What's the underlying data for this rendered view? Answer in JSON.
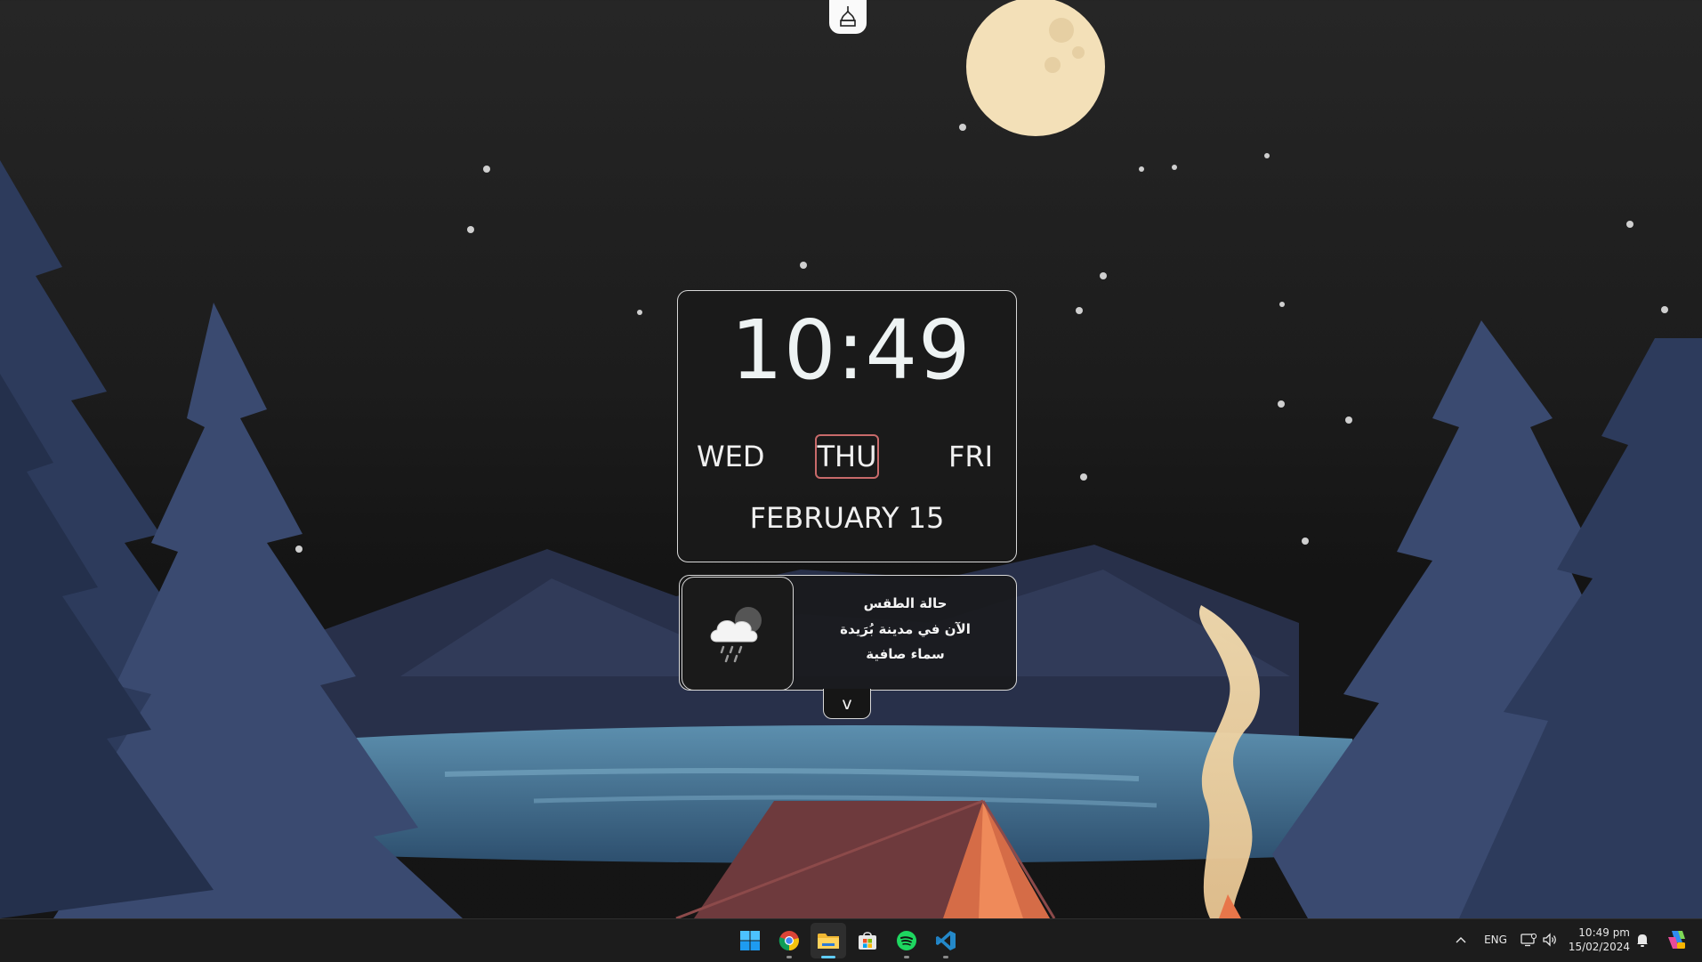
{
  "colors": {
    "accent_day_border": "#c86a6a",
    "moon": "#f3e0b8",
    "taskbar": "#1c1c1c",
    "active_indicator": "#60cdff"
  },
  "top_pill": {
    "icon": "mosque-icon"
  },
  "clock": {
    "time": "10:49",
    "days": {
      "previous": "WED",
      "current": "THU",
      "next": "FRI"
    },
    "date": "FEBRUARY 15"
  },
  "weather": {
    "icon": "cloud-rain-night-icon",
    "title": "حالة الطقس",
    "city": "الآن في مدينة بُرَيدة",
    "condition": "سماء صافية",
    "expand_label": "v"
  },
  "taskbar": {
    "apps": [
      {
        "name": "start-button",
        "icon": "windows-logo-icon"
      },
      {
        "name": "chrome",
        "icon": "chrome-icon"
      },
      {
        "name": "file-explorer",
        "icon": "folder-icon",
        "active": true
      },
      {
        "name": "microsoft-store",
        "icon": "store-icon"
      },
      {
        "name": "spotify",
        "icon": "spotify-icon"
      },
      {
        "name": "vscode",
        "icon": "vscode-icon"
      }
    ],
    "tray": {
      "overflow_icon": "chevron-up-icon",
      "language": "ENG",
      "network_icon": "network-icon",
      "volume_icon": "volume-icon",
      "time": "10:49 pm",
      "date": "15/02/2024",
      "notification_icon": "bell-icon",
      "copilot_icon": "copilot-icon"
    }
  }
}
